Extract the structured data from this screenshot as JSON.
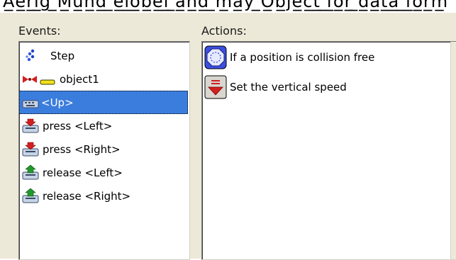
{
  "window": {
    "top_partial_text": "A̲e̲r̲i̲g̲ ̲M̲u̲n̲d̲ ̲e̲l̲o̲b̲e̲l̲ ̲a̲n̲d̲ ̲m̲a̲y̲ ̲O̲b̲j̲e̲c̲t̲ ̲f̲o̲r̲ ̲d̲a̲t̲a̲ ̲f̲o̲r̲m̲"
  },
  "events_panel": {
    "header": "Events:",
    "items": [
      {
        "label": "Step",
        "icon": "step-icon",
        "selected": false
      },
      {
        "label": "object1",
        "icon": "collision-icon",
        "selected": false
      },
      {
        "label": "<Up>",
        "icon": "keyboard-icon",
        "selected": true
      },
      {
        "label": "press <Left>",
        "icon": "key-press-icon",
        "selected": false
      },
      {
        "label": "press <Right>",
        "icon": "key-press-icon",
        "selected": false
      },
      {
        "label": "release <Left>",
        "icon": "key-release-icon",
        "selected": false
      },
      {
        "label": "release <Right>",
        "icon": "key-release-icon",
        "selected": false
      }
    ]
  },
  "actions_panel": {
    "header": "Actions:",
    "items": [
      {
        "label": "If a position is collision free",
        "icon": "collision-free-icon"
      },
      {
        "label": "Set the vertical speed",
        "icon": "vertical-speed-icon"
      }
    ]
  },
  "colors": {
    "selection": "#3b7ddd",
    "panel_bg": "#ece9d8"
  }
}
